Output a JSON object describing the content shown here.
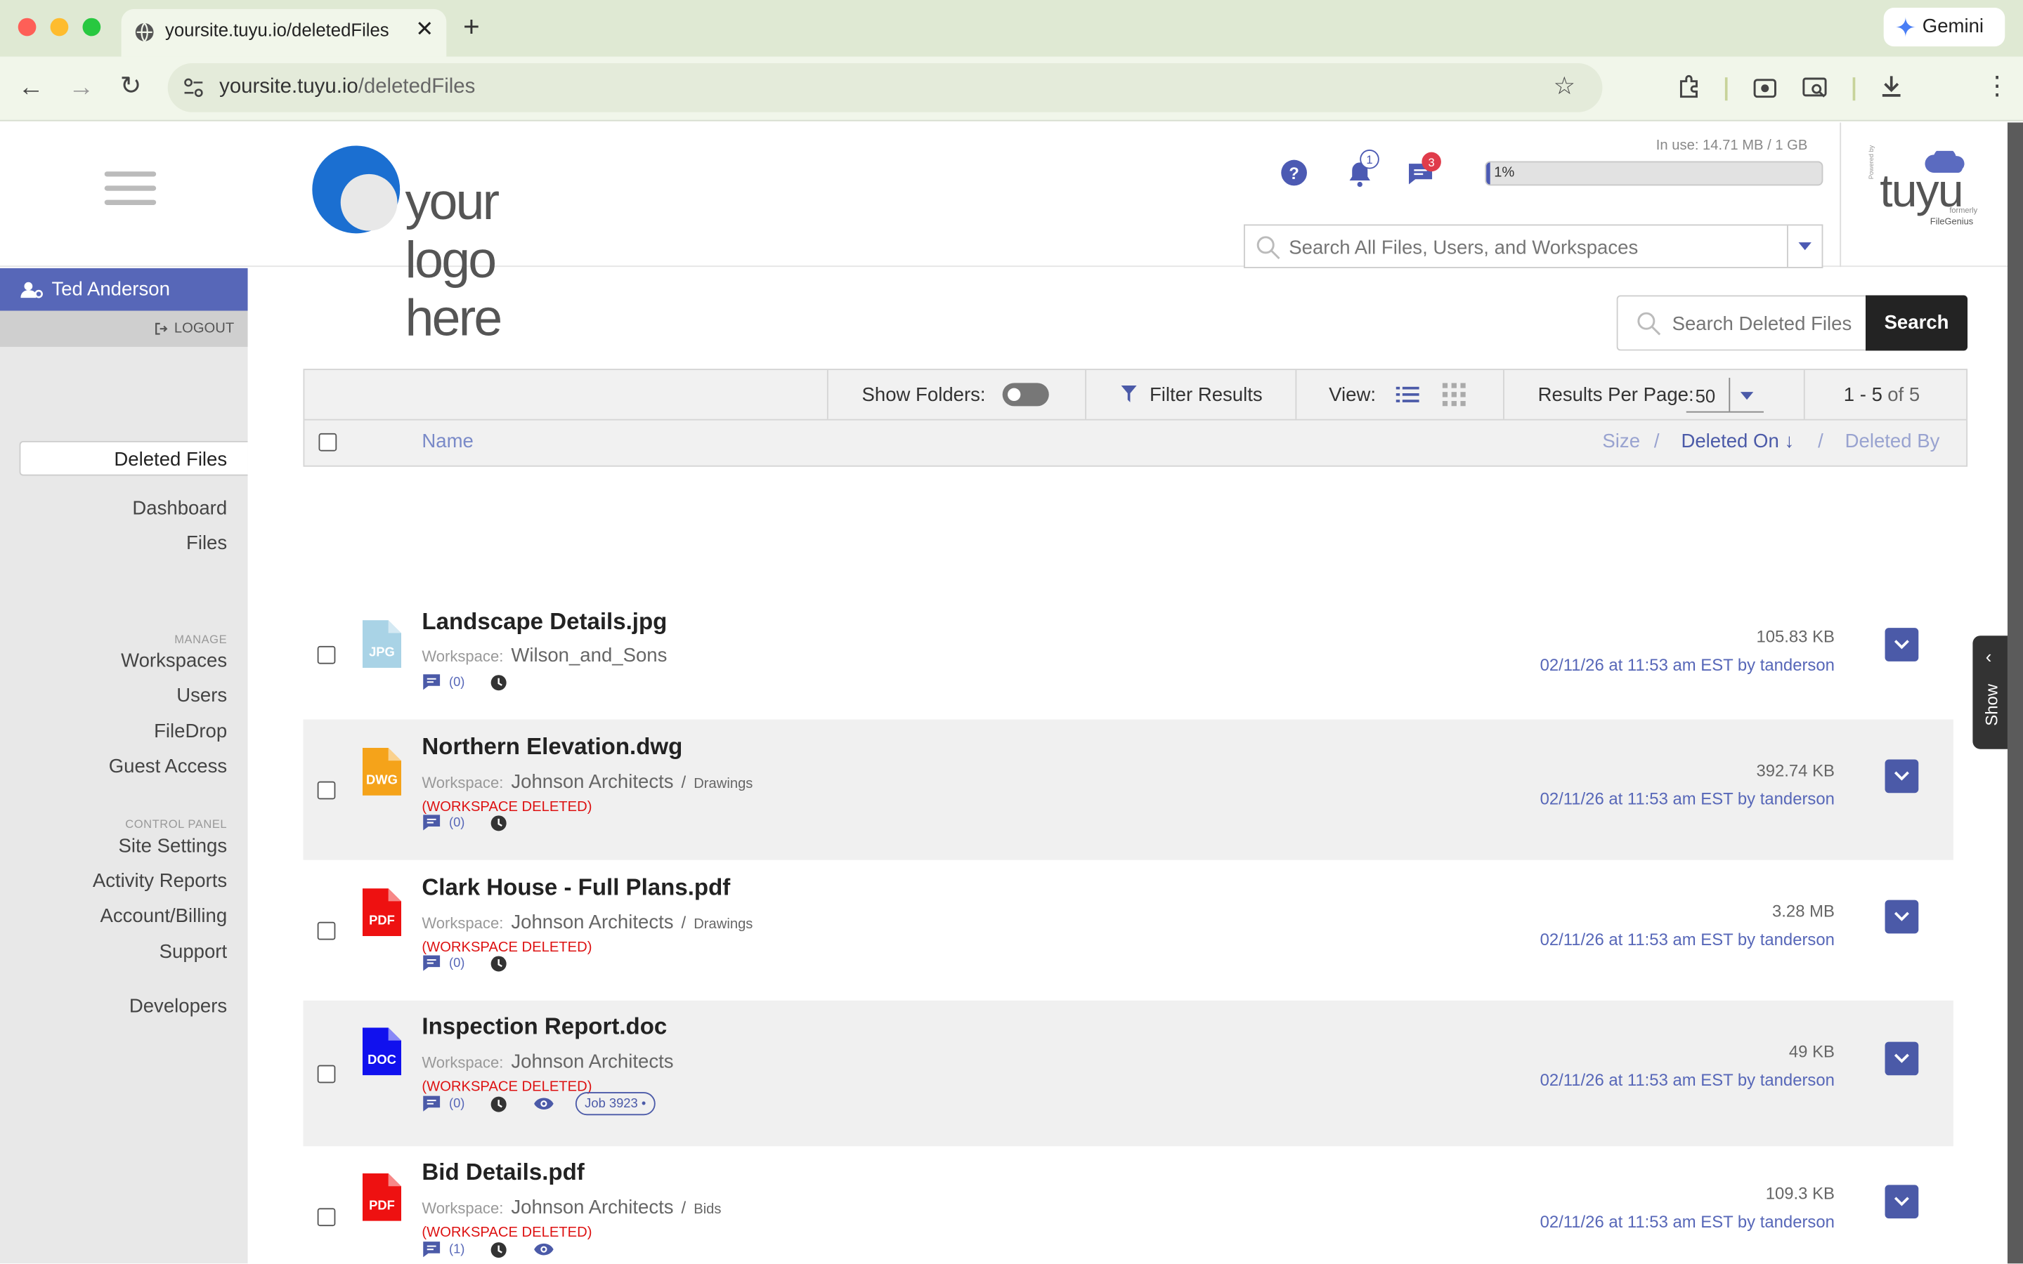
{
  "browser": {
    "tab_title": "yoursite.tuyu.io/deletedFiles",
    "url_host": "yoursite.tuyu.io",
    "url_path": "/deletedFiles",
    "gemini_label": "Gemini"
  },
  "header": {
    "logo_text": "your logo here",
    "notifications_count": "1",
    "messages_count": "3",
    "usage_text": "In use: 14.71 MB / 1 GB",
    "usage_percent_label": "1%",
    "usage_fraction": 0.01,
    "global_search_placeholder": "Search All Files, Users, and Workspaces",
    "brand": {
      "powered_by": "Powered by",
      "name": "tuyu",
      "formerly": "formerly",
      "old_name": "FileGenius"
    }
  },
  "sidebar": {
    "user_name": "Ted Anderson",
    "logout_label": "LOGOUT",
    "items": [
      "Dashboard",
      "Files",
      "Deleted Files"
    ],
    "manage_heading": "MANAGE",
    "manage_items": [
      "Workspaces",
      "Users",
      "FileDrop",
      "Guest Access"
    ],
    "control_heading": "CONTROL PANEL",
    "control_items": [
      "Site Settings",
      "Activity Reports",
      "Account/Billing",
      "Support"
    ],
    "developers": "Developers"
  },
  "main": {
    "search_placeholder": "Search Deleted Files",
    "search_button": "Search",
    "show_folders_label": "Show Folders:",
    "filter_label": "Filter Results",
    "view_label": "View:",
    "per_page_label": "Results Per Page:",
    "per_page_value": "50",
    "range_label": "1 - 5",
    "of_label": "of 5",
    "col_name": "Name",
    "col_size": "Size",
    "col_deleted_on": "Deleted On",
    "col_deleted_by": "Deleted By",
    "slash": "/",
    "workspace_label": "Workspace:",
    "workspace_deleted": "(WORKSPACE DELETED)",
    "show_tab": "Show"
  },
  "files": [
    {
      "name": "Landscape Details.jpg",
      "ext": "JPG",
      "color": "#a9d3e6",
      "workspace": "Wilson_and_Sons",
      "sub": "",
      "deleted_ws": false,
      "comments": "(0)",
      "size": "105.83 KB",
      "date": "02/11/26 at 11:53 am EST by tanderson"
    },
    {
      "name": "Northern Elevation.dwg",
      "ext": "DWG",
      "color": "#f5a31a",
      "workspace": "Johnson Architects",
      "sub": "Drawings",
      "deleted_ws": true,
      "comments": "(0)",
      "size": "392.74 KB",
      "date": "02/11/26 at 11:53 am EST by tanderson"
    },
    {
      "name": "Clark House - Full Plans.pdf",
      "ext": "PDF",
      "color": "#ee1111",
      "workspace": "Johnson Architects",
      "sub": "Drawings",
      "deleted_ws": true,
      "comments": "(0)",
      "size": "3.28 MB",
      "date": "02/11/26 at 11:53 am EST by tanderson"
    },
    {
      "name": "Inspection Report.doc",
      "ext": "DOC",
      "color": "#1111ee",
      "workspace": "Johnson Architects",
      "sub": "",
      "deleted_ws": true,
      "comments": "(0)",
      "tag": "Job 3923",
      "size": "49 KB",
      "date": "02/11/26 at 11:53 am EST by tanderson"
    },
    {
      "name": "Bid Details.pdf",
      "ext": "PDF",
      "color": "#ee1111",
      "workspace": "Johnson Architects",
      "sub": "Bids",
      "deleted_ws": true,
      "comments": "(1)",
      "size": "109.3 KB",
      "date": "02/11/26 at 11:53 am EST by tanderson"
    }
  ]
}
